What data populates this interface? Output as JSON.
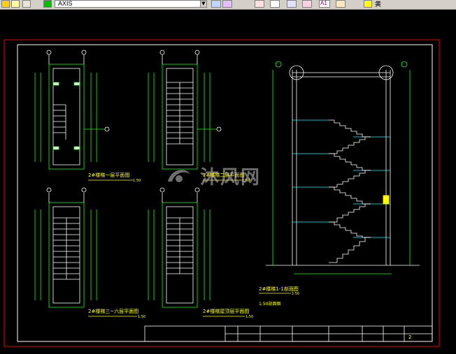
{
  "toolbar": {
    "layer_name": "AXIS",
    "text_style_label": "A1",
    "extra_label": "黄"
  },
  "sheet": {
    "frame_color": "#c00000",
    "inner_border_color": "#ffffff",
    "line_color": "#00ff00",
    "accent_color": "#ffff00",
    "axis_color": "#ffffff",
    "section_color": "#00ffff"
  },
  "plans": [
    {
      "title": "2#楼梯一层平面图",
      "scale": "1:50"
    },
    {
      "title": "2#楼梯二层平面图",
      "scale": "1:50"
    },
    {
      "title": "2#楼梯三~六层平面图",
      "scale": "1:50"
    },
    {
      "title": "2#楼梯屋顶层平面图",
      "scale": "1:50"
    }
  ],
  "section": {
    "title": "2#楼梯1-1剖面图",
    "scale": "1:50",
    "note": "1:50剖面图"
  },
  "watermark": {
    "text": "沐风网"
  },
  "title_block": {
    "sheet_no": "2"
  }
}
